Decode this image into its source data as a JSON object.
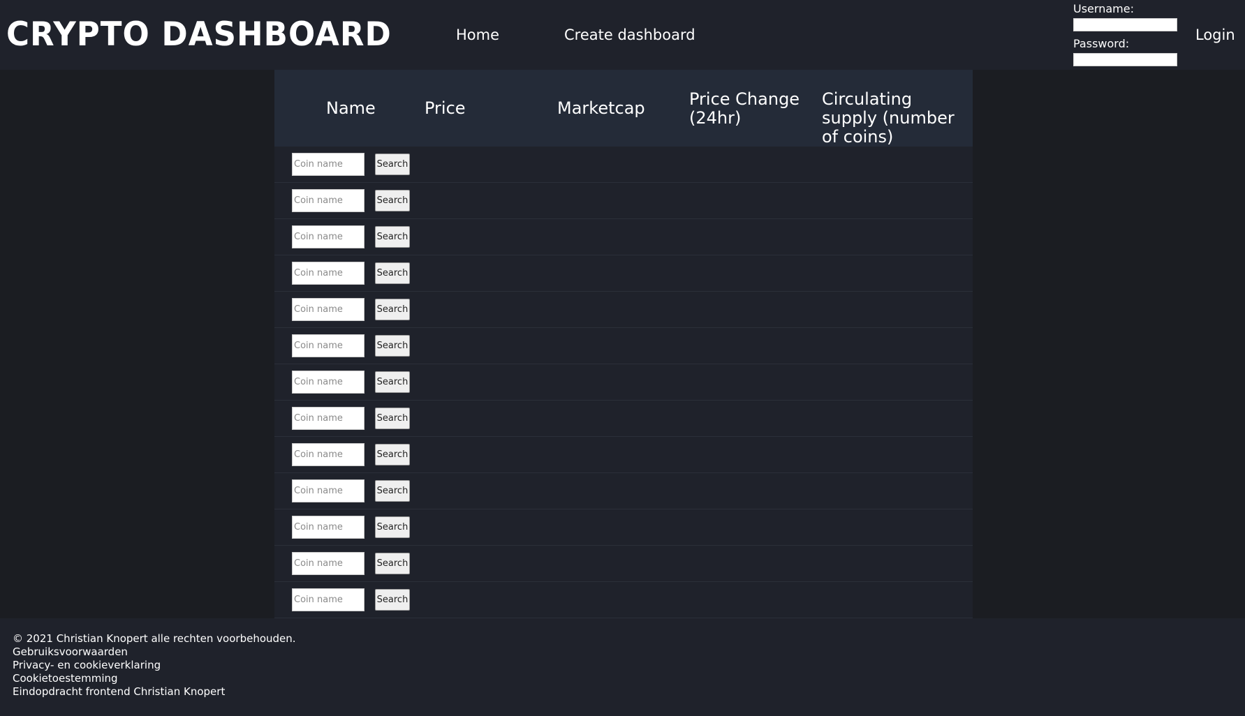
{
  "header": {
    "brand": "CRYPTO DASHBOARD",
    "nav": [
      {
        "label": "Home"
      },
      {
        "label": "Create dashboard"
      }
    ],
    "login": {
      "username_label": "Username:",
      "password_label": "Password:",
      "username_value": "",
      "password_value": "",
      "login_label": "Login"
    }
  },
  "table": {
    "columns": [
      "Name",
      "Price",
      "Marketcap",
      "Price Change (24hr)",
      "Circulating supply (number of coins)"
    ],
    "rows": [
      {
        "input_placeholder": "Coin name",
        "button_label": "Search"
      },
      {
        "input_placeholder": "Coin name",
        "button_label": "Search"
      },
      {
        "input_placeholder": "Coin name",
        "button_label": "Search"
      },
      {
        "input_placeholder": "Coin name",
        "button_label": "Search"
      },
      {
        "input_placeholder": "Coin name",
        "button_label": "Search"
      },
      {
        "input_placeholder": "Coin name",
        "button_label": "Search"
      },
      {
        "input_placeholder": "Coin name",
        "button_label": "Search"
      },
      {
        "input_placeholder": "Coin name",
        "button_label": "Search"
      },
      {
        "input_placeholder": "Coin name",
        "button_label": "Search"
      },
      {
        "input_placeholder": "Coin name",
        "button_label": "Search"
      },
      {
        "input_placeholder": "Coin name",
        "button_label": "Search"
      },
      {
        "input_placeholder": "Coin name",
        "button_label": "Search"
      },
      {
        "input_placeholder": "Coin name",
        "button_label": "Search"
      }
    ]
  },
  "footer": {
    "lines": [
      "© 2021 Christian Knopert alle rechten voorbehouden.",
      "Gebruiksvoorwaarden",
      "Privacy- en cookieverklaring",
      "Cookietoestemming",
      "Eindopdracht frontend Christian Knopert"
    ]
  },
  "colors": {
    "page_bg": "#1b1d22",
    "header_bg": "#1f222b",
    "table_header_bg": "#242b38",
    "row_bg": "#1f222b",
    "text": "#ffffff"
  }
}
